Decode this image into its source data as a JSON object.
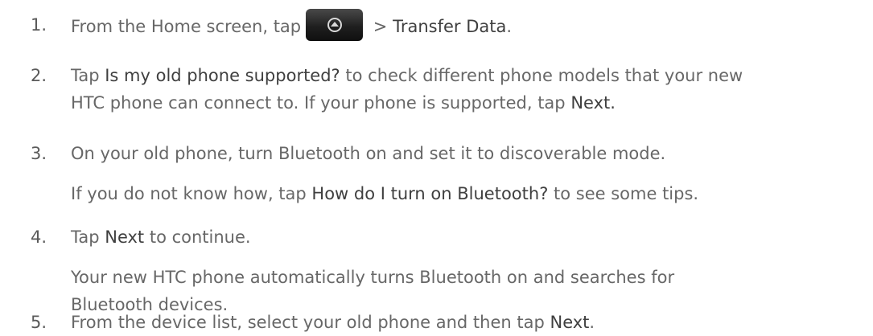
{
  "steps": [
    {
      "num": "1.",
      "pre": "From the Home screen, tap",
      "icon": "home-all-apps-icon",
      "post_sep": " > ",
      "post_em": "Transfer Data",
      "post_end": "."
    },
    {
      "num": "2.",
      "line1_pre": "Tap ",
      "line1_em": "Is my old phone supported?",
      "line1_post": " to check different phone models that your new",
      "line2_pre": "HTC phone can connect to. If your phone is supported, tap ",
      "line2_em": "Next.",
      "line2_post": ""
    },
    {
      "num": "3.",
      "text": "On your old phone, turn Bluetooth on and set it to discoverable mode."
    },
    {
      "num": "4.",
      "pre": "Tap ",
      "em": "Next",
      "post": " to continue."
    },
    {
      "num": "5.",
      "pre": "From the device list, select your old phone and then tap ",
      "em": "Next",
      "post": "."
    }
  ],
  "paragraphs": {
    "bluetooth_tip_pre": "If you do not know how, tap ",
    "bluetooth_tip_em": "How do I turn on Bluetooth?",
    "bluetooth_tip_post": " to see some tips.",
    "auto_line1": "Your new HTC phone automatically turns Bluetooth on and searches for",
    "auto_line2": "Bluetooth devices."
  }
}
